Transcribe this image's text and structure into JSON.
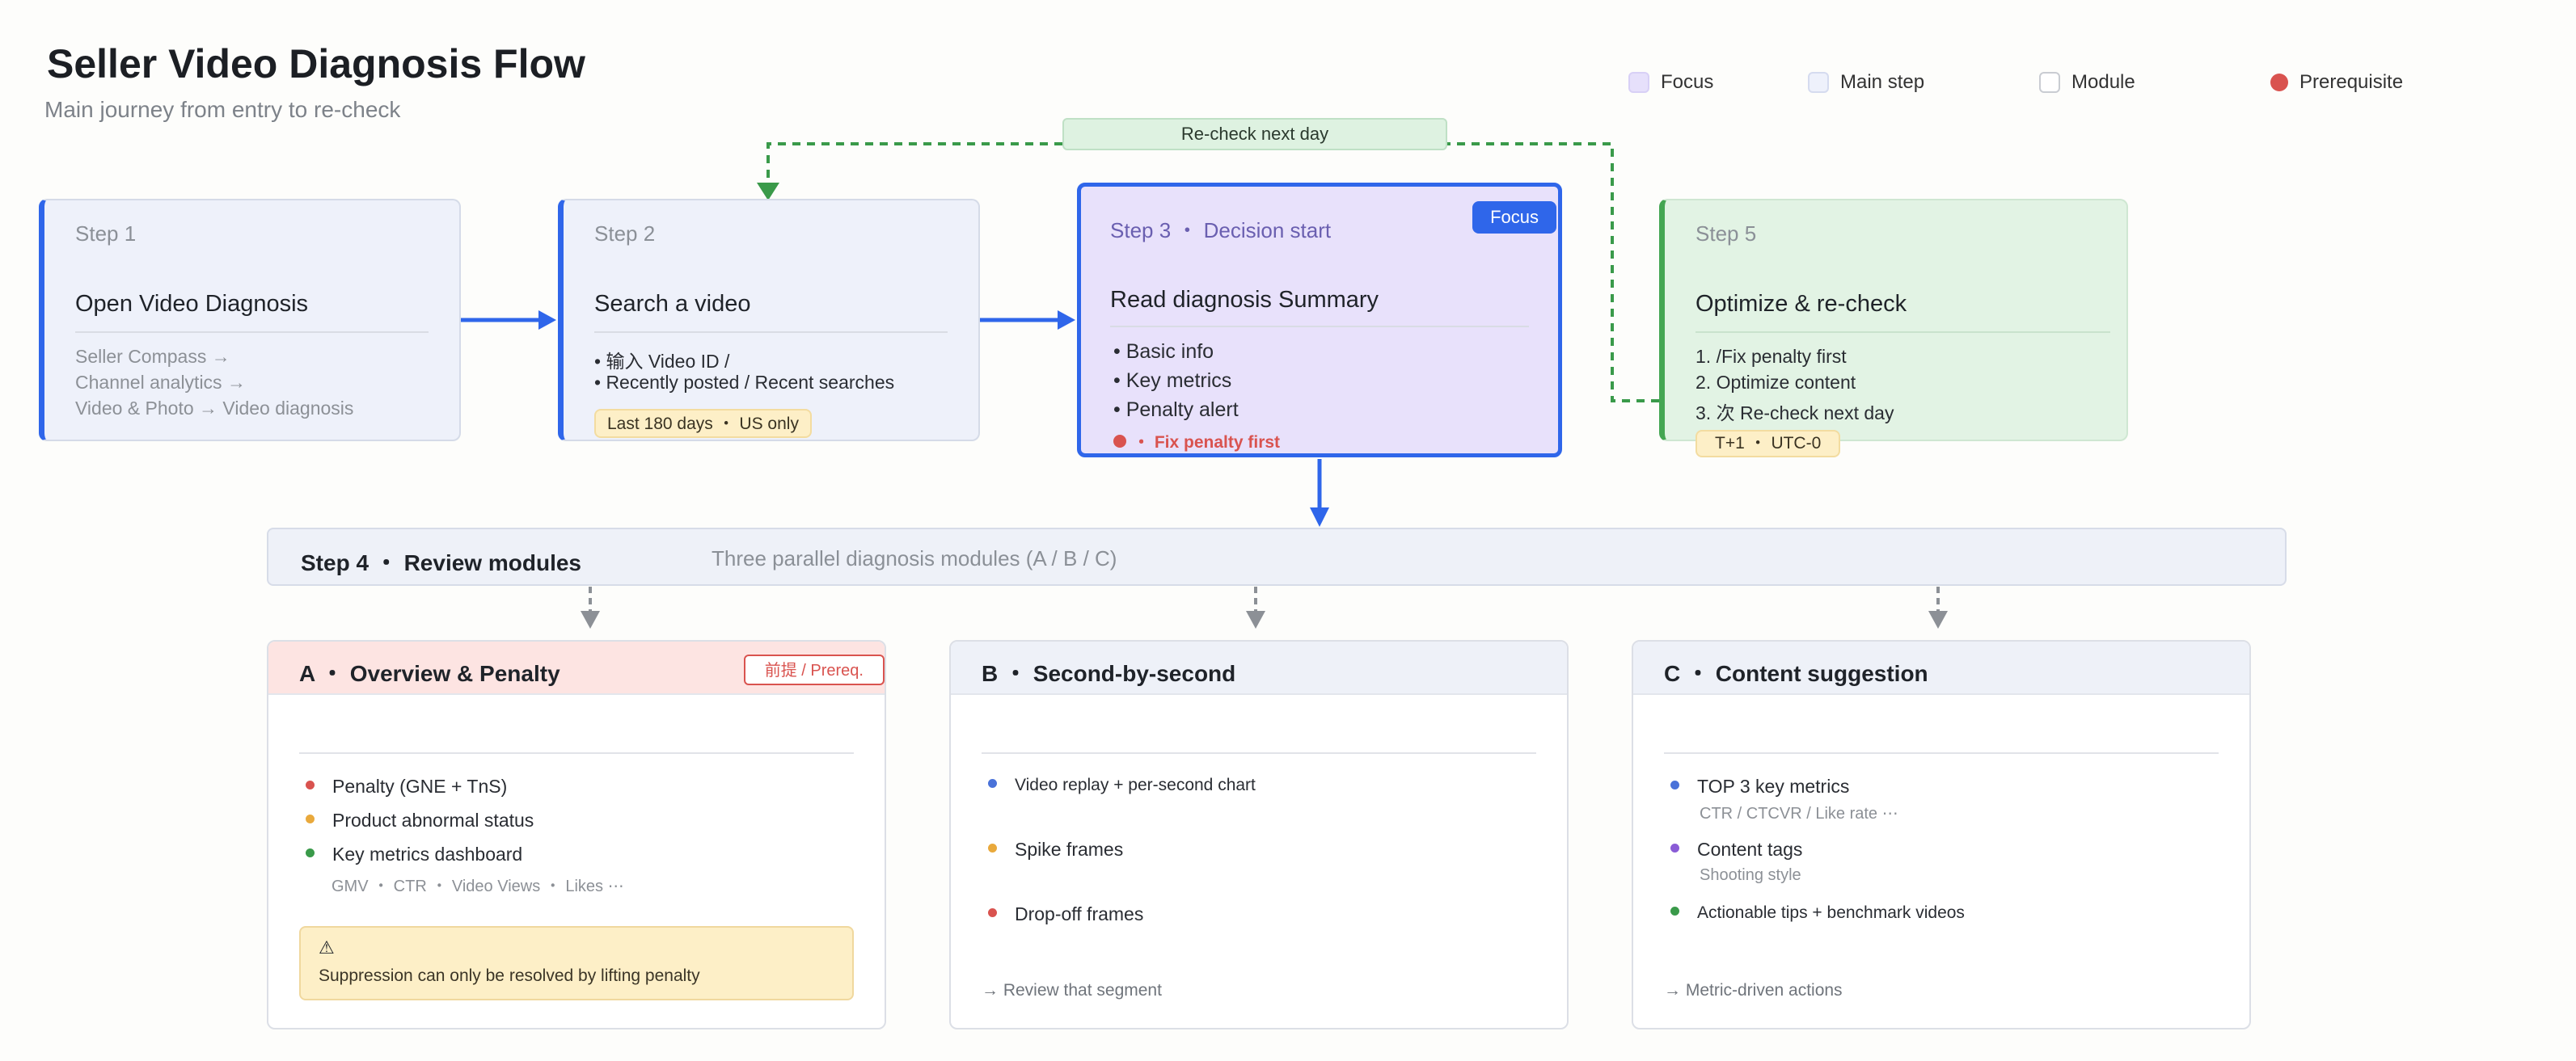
{
  "header": {
    "title": "Seller Video Diagnosis Flow",
    "subtitle": "Main journey from entry to re-check"
  },
  "legend": {
    "focus": "Focus",
    "main_step": "Main step",
    "module": "Module",
    "prerequisite": "Prerequisite"
  },
  "recheck_label": "Re-check next day",
  "steps": {
    "step1": {
      "num": "Step 1",
      "title": "Open Video Diagnosis",
      "lines": [
        "Seller Compass →",
        "Channel analytics →",
        "Video & Photo → Video diagnosis"
      ]
    },
    "step2": {
      "num": "Step 2",
      "title": "Search a video",
      "lines": [
        "• 输入 Video ID /",
        "• Recently posted / Recent searches"
      ],
      "tag": "Last 180 days ・ US only"
    },
    "step3": {
      "num": "Step 3 ・ Decision start",
      "title": "Read diagnosis Summary",
      "badge": "Focus",
      "lines": [
        "• Basic info",
        "• Key metrics",
        "• Penalty alert"
      ],
      "alert": "・ Fix penalty first"
    },
    "step5": {
      "num": "Step 5",
      "title": "Optimize & re-check",
      "lines": [
        "1. /Fix penalty first",
        "2. Optimize content",
        "3. 次 Re-check next day"
      ],
      "tag": "T+1 ・ UTC-0"
    }
  },
  "step4": {
    "title": "Step 4 ・ Review modules",
    "subtitle": "Three parallel diagnosis modules (A / B / C)"
  },
  "modules": {
    "a": {
      "title": "A ・ Overview & Penalty",
      "badge": "前提 / Prereq.",
      "items": [
        "Penalty (GNE + TnS)",
        "Product abnormal status",
        "Key metrics dashboard"
      ],
      "sub": "GMV ・ CTR ・ Video Views ・ Likes ⋯",
      "warn_icon": "⚠",
      "warn_text": "Suppression can only be resolved by lifting penalty"
    },
    "b": {
      "title": "B ・ Second-by-second",
      "items": [
        "Video replay + per-second chart",
        "Spike frames",
        "Drop-off frames"
      ],
      "footer": "→ Review that segment"
    },
    "c": {
      "title": "C ・ Content suggestion",
      "items": [
        "TOP 3 key metrics",
        "Content tags",
        "Actionable tips + benchmark videos"
      ],
      "sub1": "CTR / CTCVR / Like rate ⋯",
      "sub2": "Shooting style",
      "footer": "→ Metric-driven actions"
    }
  },
  "colors": {
    "accent_blue": "#2f66ea",
    "prereq_red": "#d9534f",
    "focus_bg": "#e8e1fb",
    "main_bg": "#eef1fa",
    "done_green": "#45a653",
    "warn_yellow": "#fdefc7"
  }
}
